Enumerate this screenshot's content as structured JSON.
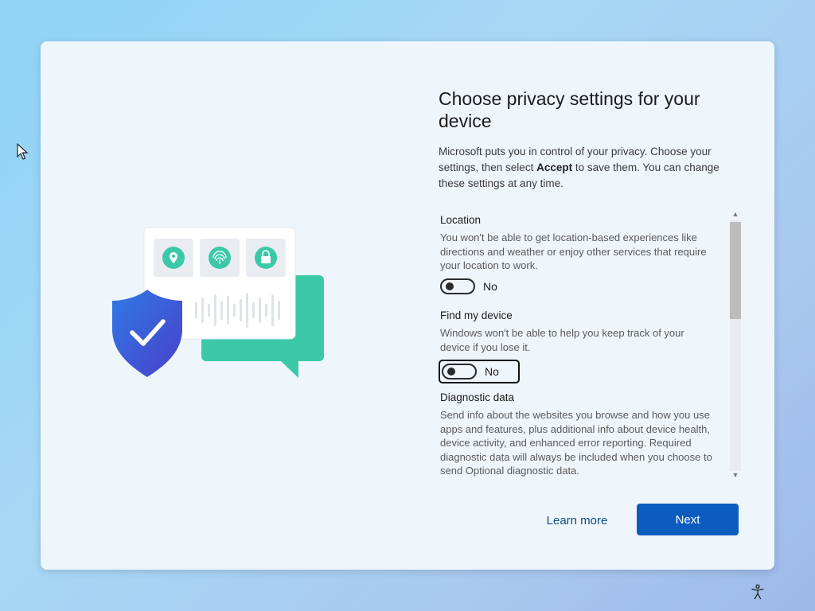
{
  "page": {
    "title": "Choose privacy settings for your device",
    "intro_before": "Microsoft puts you in control of your privacy. Choose your settings, then select ",
    "intro_bold": "Accept",
    "intro_after": " to save them. You can change these settings at any time."
  },
  "settings": [
    {
      "title": "Location",
      "description": "You won't be able to get location-based experiences like directions and weather or enjoy other services that require your location to work.",
      "toggle_label": "No",
      "toggle_on": false
    },
    {
      "title": "Find my device",
      "description": "Windows won't be able to help you keep track of your device if you lose it.",
      "toggle_label": "No",
      "toggle_on": false
    },
    {
      "title": "Diagnostic data",
      "description": "Send info about the websites you browse and how you use apps and features, plus additional info about device health, device activity, and enhanced error reporting. Required diagnostic data will always be included when you choose to send Optional diagnostic data."
    }
  ],
  "buttons": {
    "learn_more": "Learn more",
    "next": "Next"
  },
  "colors": {
    "accent": "#0b5cbe",
    "link": "#0f4c8a",
    "shield": "#3556d8",
    "chat_bubble": "#3cc9a8"
  },
  "icons": [
    "mouse-pointer-icon",
    "location-pin-icon",
    "fingerprint-icon",
    "lock-icon",
    "shield-check-icon",
    "chevron-up-icon",
    "chevron-down-icon",
    "accessibility-icon"
  ]
}
